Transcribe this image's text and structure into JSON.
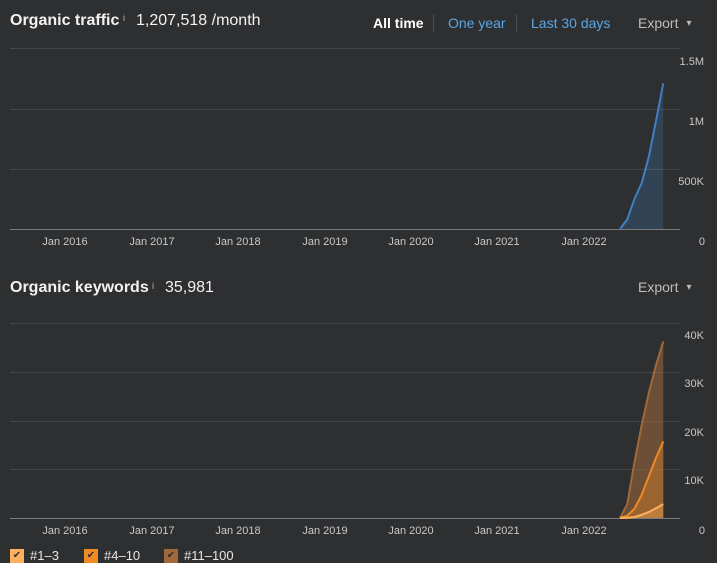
{
  "traffic": {
    "title": "Organic traffic",
    "info": "i",
    "value": "1,207,518 /month",
    "ranges": [
      "All time",
      "One year",
      "Last 30 days"
    ],
    "active_range": "All time",
    "export_label": "Export",
    "export_chevron": "▾"
  },
  "keywords": {
    "title": "Organic keywords",
    "info": "i",
    "value": "35,981",
    "export_label": "Export",
    "export_chevron": "▾"
  },
  "x_ticks": [
    "Jan 2016",
    "Jan 2017",
    "Jan 2018",
    "Jan 2019",
    "Jan 2020",
    "Jan 2021",
    "Jan 2022"
  ],
  "legend": [
    {
      "label": "#1–3",
      "color": "#ffb05c"
    },
    {
      "label": "#4–10",
      "color": "#f08a24"
    },
    {
      "label": "#11–100",
      "color": "#a0693a"
    }
  ],
  "chart_data": [
    {
      "type": "area",
      "title": "Organic traffic",
      "y_ticks": [
        "1.5M",
        "1M",
        "500K",
        "0"
      ],
      "ylim": [
        0,
        1500000
      ],
      "x_start": "2015-07",
      "x_end": "2022-12",
      "color": "#3f7fc4",
      "series": [
        {
          "values_x": [
            "2022-06",
            "2022-07",
            "2022-08",
            "2022-09",
            "2022-10",
            "2022-11",
            "2022-12"
          ],
          "values_y": [
            0,
            80000,
            250000,
            380000,
            600000,
            900000,
            1207518
          ]
        }
      ]
    },
    {
      "type": "area",
      "title": "Organic keywords",
      "y_ticks": [
        "40K",
        "30K",
        "20K",
        "10K"
      ],
      "ylim": [
        0,
        42000
      ],
      "x_start": "2015-07",
      "x_end": "2022-12",
      "series": [
        {
          "name": "#11–100",
          "color": "#a0693a",
          "values_x": [
            "2022-06",
            "2022-07",
            "2022-08",
            "2022-09",
            "2022-10",
            "2022-11",
            "2022-12"
          ],
          "values_y": [
            0,
            3000,
            12000,
            20000,
            27000,
            33000,
            38000
          ]
        },
        {
          "name": "#4–10",
          "color": "#f08a24",
          "values_x": [
            "2022-06",
            "2022-07",
            "2022-08",
            "2022-09",
            "2022-10",
            "2022-11",
            "2022-12"
          ],
          "values_y": [
            0,
            500,
            2000,
            5000,
            9000,
            13000,
            16500
          ]
        },
        {
          "name": "#1–3",
          "color": "#ffb05c",
          "values_x": [
            "2022-06",
            "2022-07",
            "2022-08",
            "2022-09",
            "2022-10",
            "2022-11",
            "2022-12"
          ],
          "values_y": [
            0,
            50,
            200,
            700,
            1300,
            2100,
            3000
          ]
        }
      ]
    }
  ]
}
